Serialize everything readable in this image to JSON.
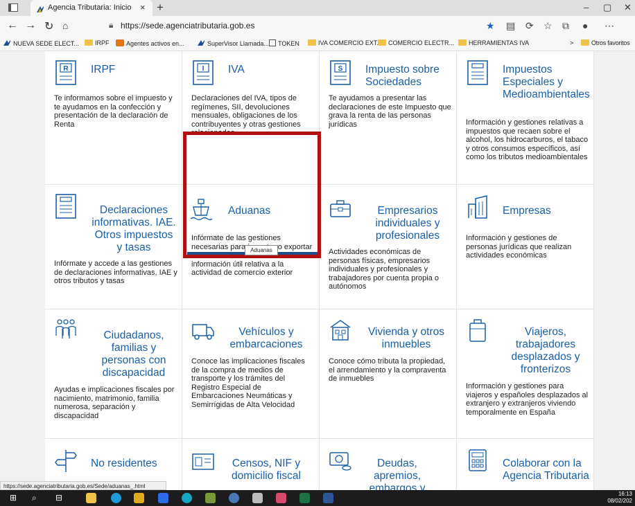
{
  "browser": {
    "tab_title": "Agencia Tributaria: Inicio",
    "url_domain": "https://sede.agenciatributaria.gob.es",
    "bookmarks": [
      "NUEVA SEDE ELECT...",
      "IRPF",
      "Agentes activos en...",
      "SuperVisor Llamada...",
      "TOKEN",
      "IVA COMERCIO EXT...",
      "COMERCIO ELECTR...",
      "HERRAMIENTAS IVA",
      "Otros favoritos"
    ],
    "status_url": "https://sede.agenciatributaria.gob.es/Sede/aduanas_.html"
  },
  "cards": [
    {
      "title": "IRPF",
      "desc": "Te informamos sobre el impuesto y te ayudamos en la confección y presentación de la declaración de Renta",
      "icon": "irpf-document-icon"
    },
    {
      "title": "IVA",
      "desc": "Declaraciones del IVA, tipos de regímenes, SII, devoluciones mensuales, obligaciones de los contribuyentes y otras gestiones relacionadas",
      "icon": "iva-document-icon"
    },
    {
      "title": "Impuesto sobre Sociedades",
      "desc": "Te ayudamos a presentar las declaraciones de este Impuesto que grava la renta de las personas jurídicas",
      "icon": "sociedades-document-icon"
    },
    {
      "title": "Impuestos Especiales y Medioambientales",
      "desc": "Información y gestiones relativas a impuestos que recaen sobre el alcohol, los hidrocarburos, el tabaco y otros consumos específicos, así como los tributos medioambientales",
      "icon": "especiales-document-icon"
    },
    {
      "title": "Declaraciones informativas. IAE. Otros impuestos y tasas",
      "desc": "Infórmate y accede a las gestiones de declaraciones informativas, IAE y otros tributos y tasas",
      "icon": "declaraciones-document-icon"
    },
    {
      "title": "Aduanas",
      "desc": "Infórmate de las gestiones necesarias para importar o exportar mercancías, así como de otra información útil relativa a la actividad de comercio exterior",
      "icon": "ship-icon"
    },
    {
      "title": "Empresarios individuales y profesionales",
      "desc": "Actividades económicas de personas físicas, empresarios individuales y profesionales y trabajadores por cuenta propia o autónomos",
      "icon": "briefcase-icon"
    },
    {
      "title": "Empresas",
      "desc": "Información y gestiones de personas jurídicas que realizan actividades económicas",
      "icon": "building-icon"
    },
    {
      "title": "Ciudadanos, familias y personas con discapacidad",
      "desc": "Ayudas e implicaciones fiscales por nacimiento, matrimonio, familia numerosa, separación y discapacidad",
      "icon": "family-icon"
    },
    {
      "title": "Vehículos y embarcaciones",
      "desc": "Conoce las implicaciones fiscales de la compra de medios de transporte y los trámites del Registro Especial de Embarcaciones Neumáticas y Semirrígidas de Alta Velocidad",
      "icon": "truck-icon"
    },
    {
      "title": "Vivienda y otros inmuebles",
      "desc": "Conoce cómo tributa la propiedad, el arrendamiento y la compraventa de inmuebles",
      "icon": "house-icon"
    },
    {
      "title": "Viajeros, trabajadores desplazados y fronterizos",
      "desc": "Información y gestiones para viajeros y españoles desplazados al extranjero y extranjeros viviendo temporalmente en España",
      "icon": "luggage-icon"
    },
    {
      "title": "No residentes",
      "desc": "",
      "icon": "signpost-icon"
    },
    {
      "title": "Censos, NIF y domicilio fiscal",
      "desc": "",
      "icon": "id-card-icon"
    },
    {
      "title": "Deudas, apremios, embargos y",
      "desc": "",
      "icon": "money-icon"
    },
    {
      "title": "Colaborar con la Agencia Tributaria",
      "desc": "",
      "icon": "calculator-icon"
    }
  ],
  "tooltip": "Aduanas",
  "clock": {
    "time": "16:13",
    "date": "08/02/202"
  }
}
